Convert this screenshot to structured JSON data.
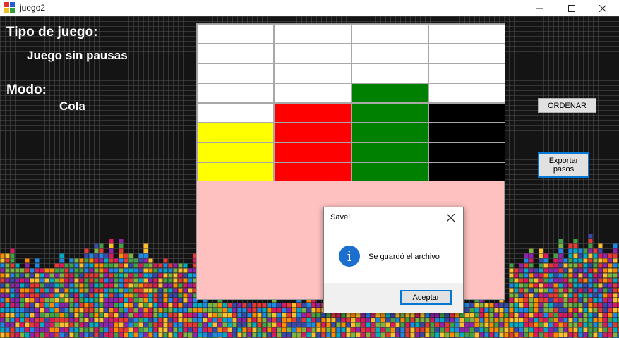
{
  "window": {
    "title": "juego2",
    "minimize_icon": "minimize-icon",
    "maximize_icon": "maximize-icon",
    "close_icon": "close-icon"
  },
  "labels": {
    "tipo_title": "Tipo de juego:",
    "tipo_value": "Juego sin pausas",
    "modo_title": "Modo:",
    "modo_value": "Cola"
  },
  "buttons": {
    "ordenar": "ORDENAR",
    "exportar_line1": "Exportar",
    "exportar_line2": "pasos"
  },
  "board": {
    "columns": 4,
    "rows": 8,
    "colors": {
      "empty": "#ffffff",
      "yellow": "#ffff00",
      "red": "#ff0000",
      "green": "#008000",
      "black": "#000000"
    },
    "cells": [
      [
        "empty",
        "empty",
        "empty",
        "empty"
      ],
      [
        "empty",
        "empty",
        "empty",
        "empty"
      ],
      [
        "empty",
        "empty",
        "empty",
        "empty"
      ],
      [
        "empty",
        "empty",
        "green",
        "empty"
      ],
      [
        "empty",
        "red",
        "green",
        "black"
      ],
      [
        "yellow",
        "red",
        "green",
        "black"
      ],
      [
        "yellow",
        "red",
        "green",
        "black"
      ],
      [
        "yellow",
        "red",
        "green",
        "black"
      ]
    ]
  },
  "lower_panel_color": "#ffc0c0",
  "dialog": {
    "title": "Save!",
    "icon": "info-icon",
    "message": "Se guardó el archivo",
    "ok_label": "Aceptar",
    "close_icon": "close-icon"
  }
}
